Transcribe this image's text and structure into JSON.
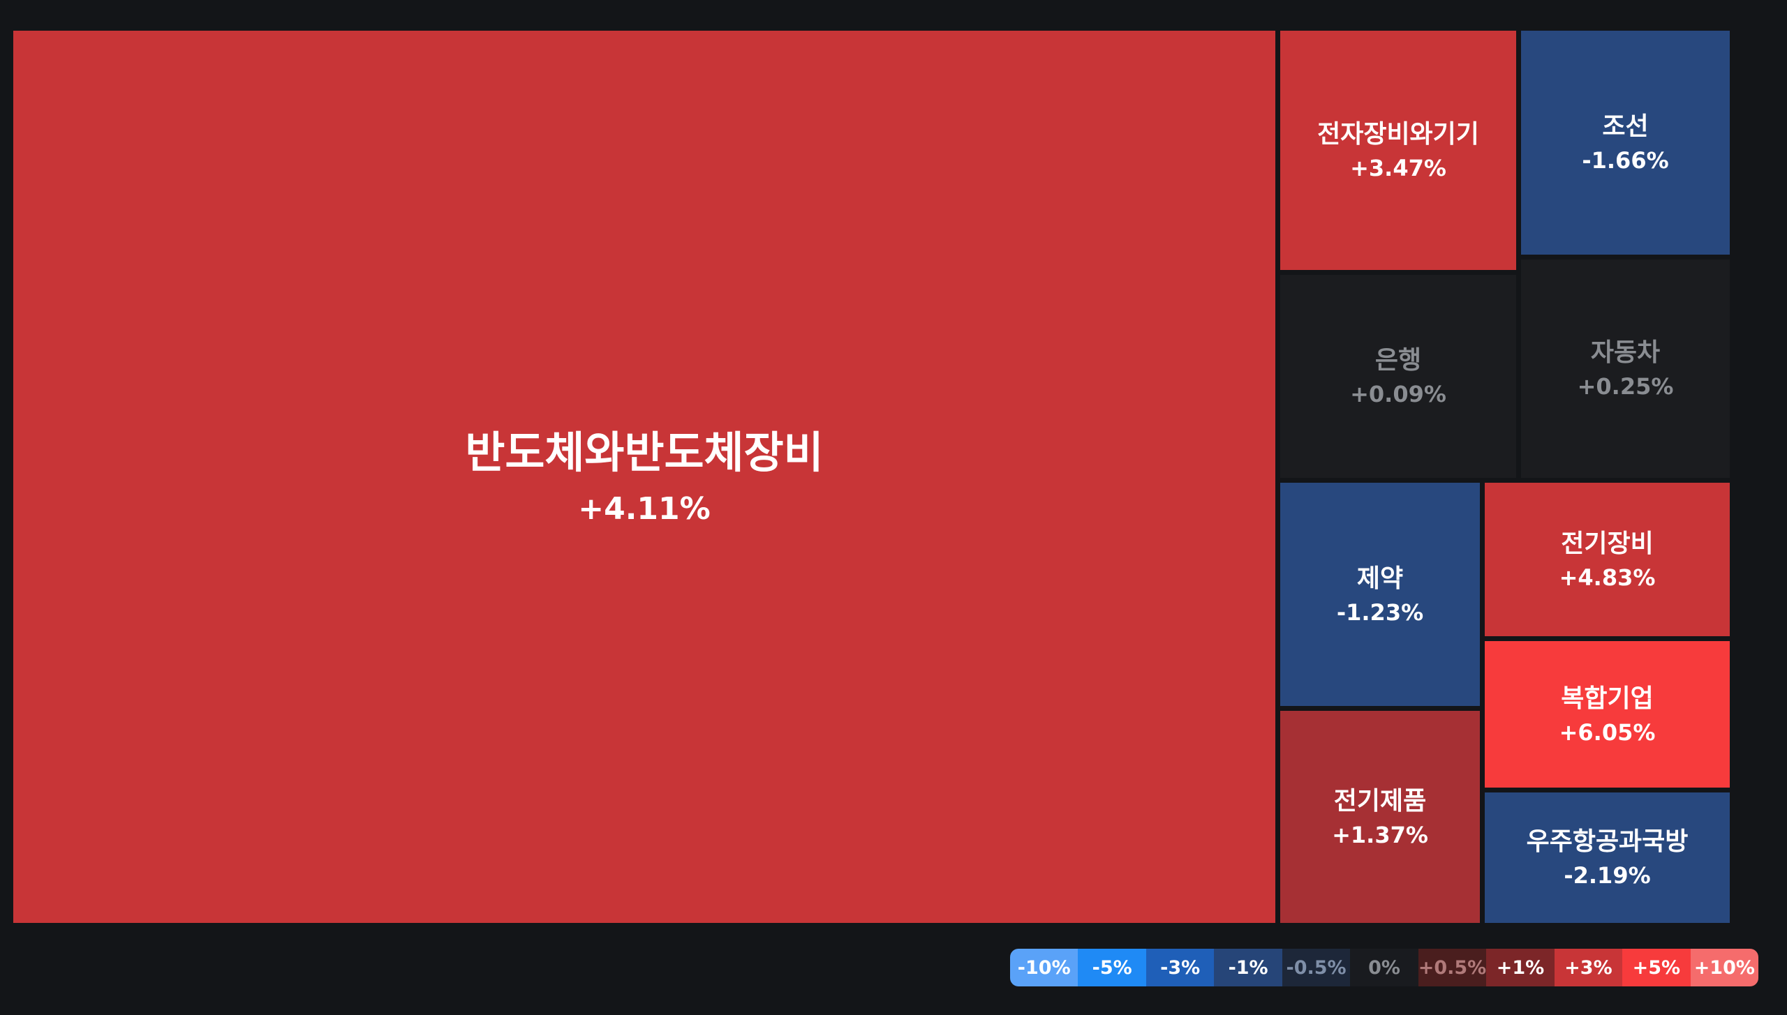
{
  "chart_data": {
    "type": "heatmap",
    "sectors": [
      {
        "name": "반도체와반도체장비",
        "change": "+4.11%",
        "value": 4.11
      },
      {
        "name": "전자장비와기기",
        "change": "+3.47%",
        "value": 3.47
      },
      {
        "name": "조선",
        "change": "-1.66%",
        "value": -1.66
      },
      {
        "name": "은행",
        "change": "+0.09%",
        "value": 0.09
      },
      {
        "name": "자동차",
        "change": "+0.25%",
        "value": 0.25
      },
      {
        "name": "제약",
        "change": "-1.23%",
        "value": -1.23
      },
      {
        "name": "전기장비",
        "change": "+4.83%",
        "value": 4.83
      },
      {
        "name": "복합기업",
        "change": "+6.05%",
        "value": 6.05
      },
      {
        "name": "전기제품",
        "change": "+1.37%",
        "value": 1.37
      },
      {
        "name": "우주항공과국방",
        "change": "-2.19%",
        "value": -2.19
      }
    ],
    "legend": [
      {
        "label": "-10%",
        "color": "#5aa2f8"
      },
      {
        "label": "-5%",
        "color": "#1f8af5"
      },
      {
        "label": "-3%",
        "color": "#1f5fb8"
      },
      {
        "label": "-1%",
        "color": "#264578"
      },
      {
        "label": "-0.5%",
        "color": "#1d2739"
      },
      {
        "label": "0%",
        "color": "#191b1f"
      },
      {
        "label": "+0.5%",
        "color": "#4a1e1e"
      },
      {
        "label": "+1%",
        "color": "#7c2628"
      },
      {
        "label": "+3%",
        "color": "#c83537"
      },
      {
        "label": "+5%",
        "color": "#f73b3c"
      },
      {
        "label": "+10%",
        "color": "#f56c6c"
      }
    ]
  },
  "colors": {
    "background": "#131518",
    "neutral_text": "#8a8d92",
    "muted_blue_text": "#7f8fa8",
    "muted_red_text": "#b07a7a"
  }
}
